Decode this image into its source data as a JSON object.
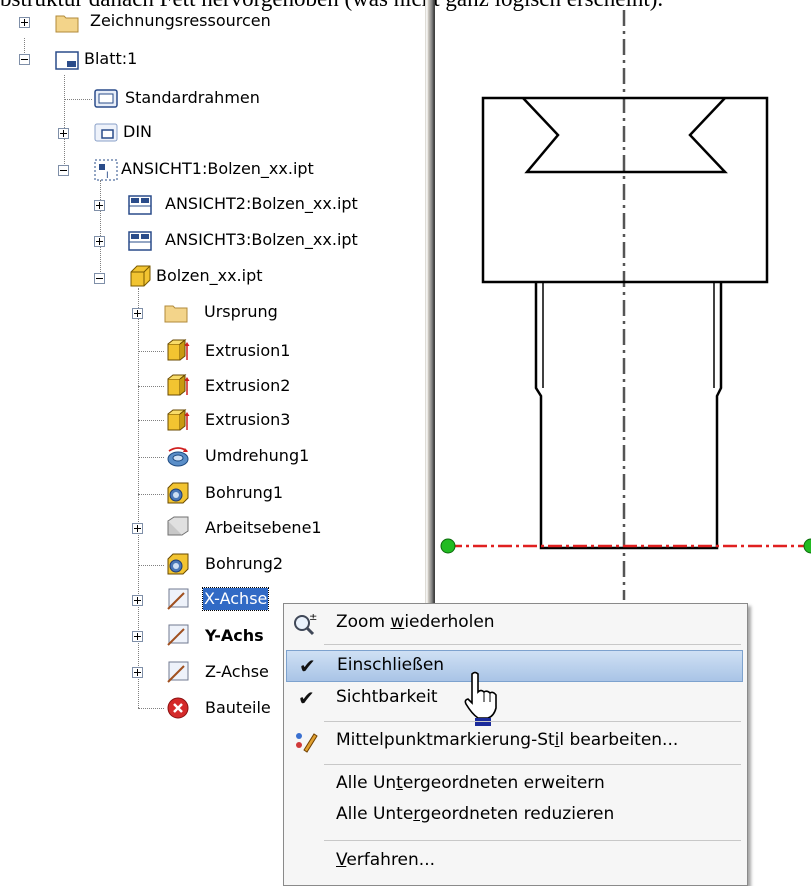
{
  "caption": "bstruktur danach Fett hervorgehoben (was nicht ganz logisch erscheint).",
  "tree": {
    "items": [
      {
        "label": "Zeichnungsressourcen"
      },
      {
        "label": "Blatt:1"
      },
      {
        "label": "Standardrahmen"
      },
      {
        "label": "DIN"
      },
      {
        "label": "ANSICHT1:Bolzen_xx.ipt"
      },
      {
        "label": "ANSICHT2:Bolzen_xx.ipt"
      },
      {
        "label": "ANSICHT3:Bolzen_xx.ipt"
      },
      {
        "label": "Bolzen_xx.ipt"
      },
      {
        "label": "Ursprung"
      },
      {
        "label": "Extrusion1"
      },
      {
        "label": "Extrusion2"
      },
      {
        "label": "Extrusion3"
      },
      {
        "label": "Umdrehung1"
      },
      {
        "label": "Bohrung1"
      },
      {
        "label": "Arbeitsebene1"
      },
      {
        "label": "Bohrung2"
      },
      {
        "label": "X-Achse"
      },
      {
        "label": "Y-Achs"
      },
      {
        "label": "Z-Achse"
      },
      {
        "label": "Bauteile"
      }
    ]
  },
  "menu": {
    "zoom": {
      "pre": "Zoom ",
      "u": "w",
      "post": "iederholen"
    },
    "einschliessen": {
      "label": "Einschließen",
      "checked": true
    },
    "sichtbarkeit": {
      "label": "Sichtbarkeit",
      "checked": true
    },
    "mittelpunkt": {
      "pre": "Mittelpunktmarkierung-St",
      "u": "i",
      "post": "l bearbeiten..."
    },
    "erweitern": {
      "pre": "Alle Un",
      "u": "t",
      "post": "ergeordneten erweitern"
    },
    "reduzieren": {
      "pre": "Alle Unte",
      "u": "r",
      "post": "geordneten reduzieren"
    },
    "verfahren": {
      "pre": "",
      "u": "V",
      "post": "erfahren..."
    }
  },
  "colors": {
    "selection": "#316ac5",
    "menu_highlight": "#b8d0ec",
    "axis_red": "#e02020",
    "point_green": "#22bb22"
  }
}
